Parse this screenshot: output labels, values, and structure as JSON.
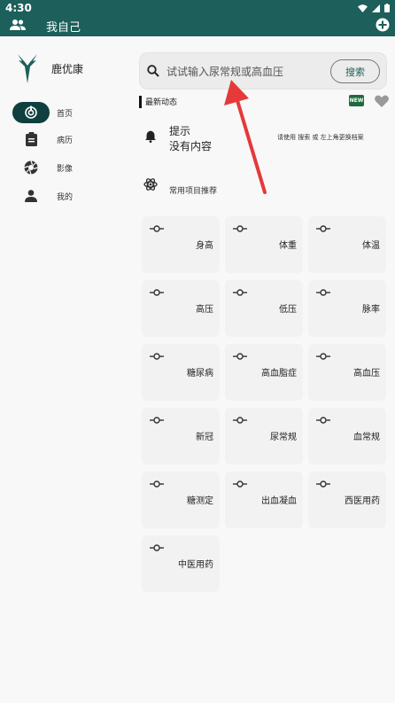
{
  "status": {
    "time": "4:30"
  },
  "appbar": {
    "title": "我自己"
  },
  "sidebar": {
    "brand": "鹿优康",
    "items": [
      {
        "label": "首页",
        "icon": "home-target-icon",
        "active": true
      },
      {
        "label": "病历",
        "icon": "clipboard-icon",
        "active": false
      },
      {
        "label": "影像",
        "icon": "aperture-icon",
        "active": false
      },
      {
        "label": "我的",
        "icon": "person-icon",
        "active": false
      }
    ]
  },
  "search": {
    "placeholder": "试试输入尿常规或高血压",
    "button": "搜索"
  },
  "news": {
    "label": "最新动态",
    "badge": "NEW"
  },
  "tip": {
    "title": "提示",
    "body": "没有内容",
    "hint": "请使用 搜索 或 左上角更换档案"
  },
  "recommend": {
    "label": "常用项目推荐"
  },
  "items": [
    "身高",
    "体重",
    "体温",
    "高压",
    "低压",
    "脉率",
    "糖尿病",
    "高血脂症",
    "高血压",
    "新冠",
    "尿常规",
    "血常规",
    "糖测定",
    "出血凝血",
    "西医用药",
    "中医用药"
  ],
  "colors": {
    "primary": "#1d5f5a",
    "active_nav": "#0f3f3e",
    "arrow": "#e5393a",
    "badge": "#1c6b3e"
  }
}
